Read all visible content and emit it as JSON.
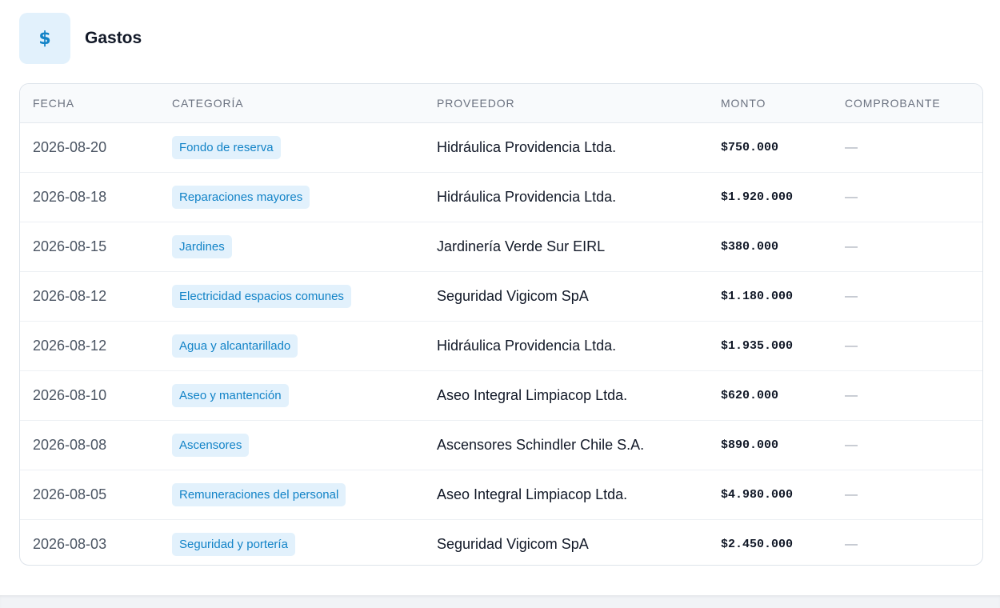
{
  "header": {
    "icon": "dollar-icon",
    "icon_glyph": "$",
    "title": "Gastos"
  },
  "table": {
    "columns": [
      "FECHA",
      "CATEGORÍA",
      "PROVEEDOR",
      "MONTO",
      "COMPROBANTE"
    ],
    "rows": [
      {
        "fecha": "2026-08-20",
        "categoria": "Fondo de reserva",
        "proveedor": "Hidráulica Providencia Ltda.",
        "monto": "$750.000",
        "comprobante": "—"
      },
      {
        "fecha": "2026-08-18",
        "categoria": "Reparaciones mayores",
        "proveedor": "Hidráulica Providencia Ltda.",
        "monto": "$1.920.000",
        "comprobante": "—"
      },
      {
        "fecha": "2026-08-15",
        "categoria": "Jardines",
        "proveedor": "Jardinería Verde Sur EIRL",
        "monto": "$380.000",
        "comprobante": "—"
      },
      {
        "fecha": "2026-08-12",
        "categoria": "Electricidad espacios comunes",
        "proveedor": "Seguridad Vigicom SpA",
        "monto": "$1.180.000",
        "comprobante": "—"
      },
      {
        "fecha": "2026-08-12",
        "categoria": "Agua y alcantarillado",
        "proveedor": "Hidráulica Providencia Ltda.",
        "monto": "$1.935.000",
        "comprobante": "—"
      },
      {
        "fecha": "2026-08-10",
        "categoria": "Aseo y mantención",
        "proveedor": "Aseo Integral Limpiacop Ltda.",
        "monto": "$620.000",
        "comprobante": "—"
      },
      {
        "fecha": "2026-08-08",
        "categoria": "Ascensores",
        "proveedor": "Ascensores Schindler Chile S.A.",
        "monto": "$890.000",
        "comprobante": "—"
      },
      {
        "fecha": "2026-08-05",
        "categoria": "Remuneraciones del personal",
        "proveedor": "Aseo Integral Limpiacop Ltda.",
        "monto": "$4.980.000",
        "comprobante": "—"
      },
      {
        "fecha": "2026-08-03",
        "categoria": "Seguridad y portería",
        "proveedor": "Seguridad Vigicom SpA",
        "monto": "$2.450.000",
        "comprobante": "—"
      }
    ]
  },
  "colors": {
    "accent": "#1283c7",
    "pill_bg": "#e2f1fc"
  }
}
